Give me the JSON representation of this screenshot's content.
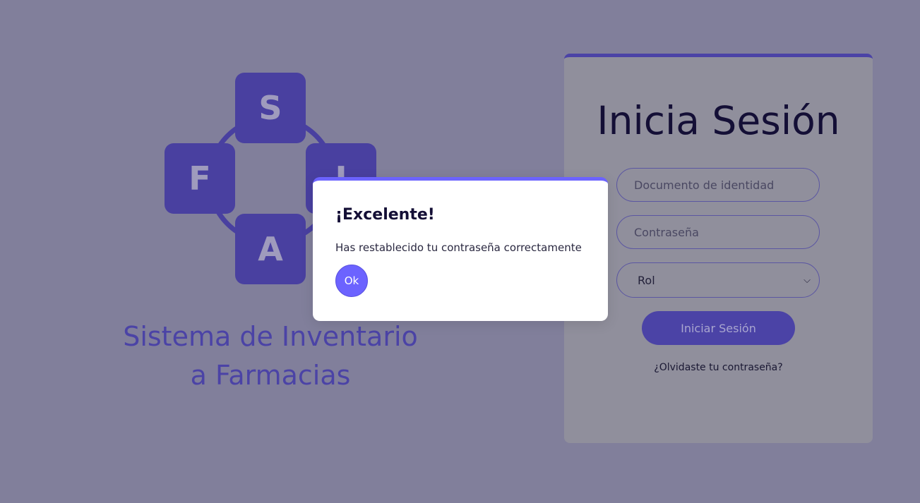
{
  "logo": {
    "letters": {
      "top": "S",
      "left": "F",
      "right": "I",
      "bottom": "A"
    }
  },
  "brand": {
    "title_line1": "Sistema de Inventario",
    "title_line2": "a Farmacias"
  },
  "login": {
    "title": "Inicia Sesión",
    "document_placeholder": "Documento de identidad",
    "password_placeholder": "Contraseña",
    "role_value": "Rol",
    "submit_label": "Iniciar Sesión",
    "forgot_label": "¿Olvidaste tu contraseña?"
  },
  "dialog": {
    "title": "¡Excelente!",
    "message": "Has restablecido tu contraseña correctamente",
    "ok_label": "Ok"
  },
  "colors": {
    "background": "#817f9b",
    "brand": "#4b43a6",
    "accent": "#6c63ff",
    "card": "#908f9c",
    "title_text": "#140f36"
  },
  "icons": {
    "role_select_chevron": "chevron-down-icon"
  }
}
